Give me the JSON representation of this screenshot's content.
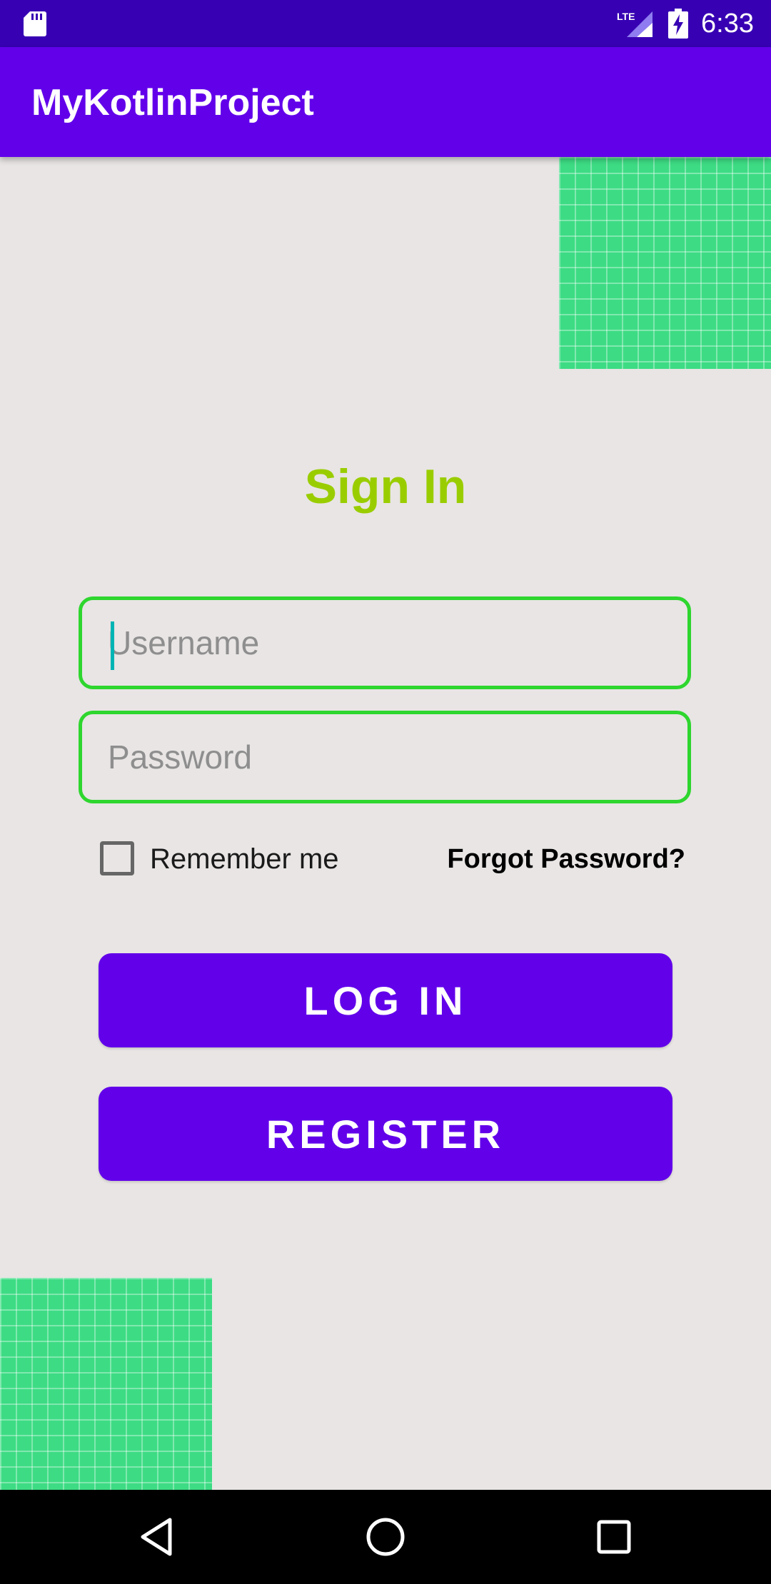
{
  "status_bar": {
    "time": "6:33",
    "network": "LTE",
    "icons": [
      "sd-card-icon",
      "lte-signal-icon",
      "battery-charging-icon"
    ]
  },
  "app_bar": {
    "title": "MyKotlinProject"
  },
  "form": {
    "heading": "Sign In",
    "username": {
      "placeholder": "Username",
      "value": ""
    },
    "password": {
      "placeholder": "Password",
      "value": ""
    },
    "remember_me": {
      "label": "Remember me",
      "checked": false
    },
    "forgot_password": "Forgot Password?",
    "login_label": "LOG IN",
    "register_label": "REGISTER"
  },
  "nav_bar": {
    "icons": [
      "back-icon",
      "home-icon",
      "recents-icon"
    ]
  },
  "colors": {
    "status_bar": "#3700b3",
    "primary": "#6200ea",
    "heading": "#9acd00",
    "field_border": "#2ed62e",
    "decoration": "#3ddc84",
    "background": "#e8e5e4"
  }
}
